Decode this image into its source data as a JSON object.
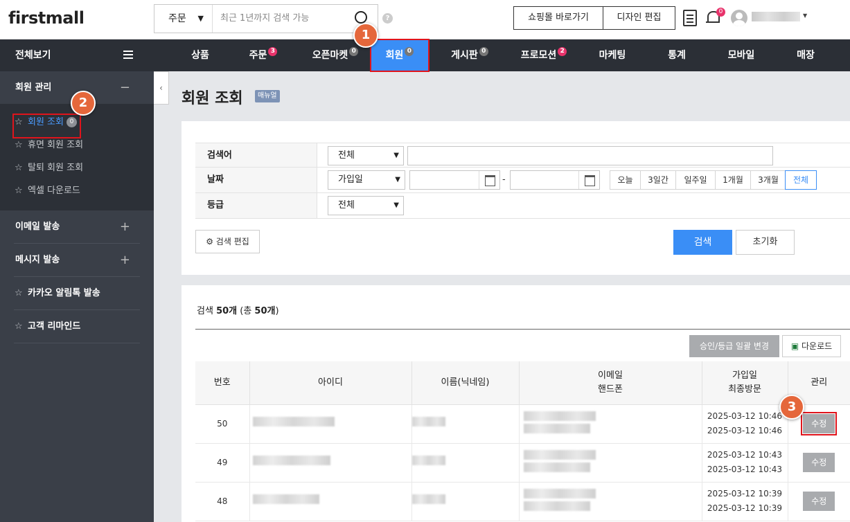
{
  "header": {
    "logo": "firstmall",
    "search_scope": "주문",
    "search_placeholder": "최근 1년까지 검색 가능",
    "help": "?",
    "shop_link": "쇼핑몰 바로가기",
    "design_edit": "디자인 편집",
    "notification_count": "0"
  },
  "nav": {
    "all_view": "전체보기",
    "items": [
      {
        "label": "상품",
        "badge": ""
      },
      {
        "label": "주문",
        "badge": "3"
      },
      {
        "label": "오픈마켓",
        "badge": "0"
      },
      {
        "label": "회원",
        "badge": "0"
      },
      {
        "label": "게시판",
        "badge": "0"
      },
      {
        "label": "프로모션",
        "badge": "2"
      },
      {
        "label": "마케팅",
        "badge": ""
      },
      {
        "label": "통계",
        "badge": ""
      },
      {
        "label": "모바일",
        "badge": ""
      },
      {
        "label": "매장",
        "badge": ""
      }
    ],
    "active": "회원"
  },
  "sidebar": {
    "group_member": "회원 관리",
    "sub": [
      {
        "label": "회원 조회",
        "count": "0"
      },
      {
        "label": "휴면 회원 조회"
      },
      {
        "label": "탈퇴 회원 조회"
      },
      {
        "label": "엑셀 다운로드"
      }
    ],
    "group_email": "이메일 발송",
    "group_message": "메시지 발송",
    "kakao": "카카오 알림톡 발송",
    "remind": "고객 리마인드",
    "collapse": "‹"
  },
  "page": {
    "title": "회원 조회",
    "manual": "매뉴얼"
  },
  "filter": {
    "keyword_label": "검색어",
    "keyword_scope": "전체",
    "date_label": "날짜",
    "date_type": "가입일",
    "date_sep": "-",
    "ranges": [
      "오늘",
      "3일간",
      "일주일",
      "1개월",
      "3개월",
      "전체"
    ],
    "range_selected": "전체",
    "grade_label": "등급",
    "grade_value": "전체",
    "edit_search": "검색 편집",
    "search_btn": "검색",
    "reset_btn": "초기화"
  },
  "results": {
    "summary_prefix": "검색 ",
    "summary_count": "50개",
    "summary_suffix": " (총 ",
    "summary_total": "50개",
    "summary_end": ")",
    "bulk_change": "승인/등급 일괄 변경",
    "download": "다운로드",
    "headers": {
      "no": "번호",
      "id": "아이디",
      "name": "이름(닉네임)",
      "email": "이메일",
      "phone": "핸드폰",
      "joined": "가입일",
      "last_visit": "최종방문",
      "manage": "관리"
    },
    "rows": [
      {
        "no": "50",
        "joined": "2025-03-12 10:46",
        "last_visit": "2025-03-12 10:46",
        "action": "수정"
      },
      {
        "no": "49",
        "joined": "2025-03-12 10:43",
        "last_visit": "2025-03-12 10:43",
        "action": "수정"
      },
      {
        "no": "48",
        "joined": "2025-03-12 10:39",
        "last_visit": "2025-03-12 10:39",
        "action": "수정"
      }
    ]
  },
  "annotations": {
    "step1": "1",
    "step2": "2",
    "step3": "3"
  },
  "colors": {
    "accent": "#3a8ef6",
    "highlight": "#e0141c",
    "step_marker": "#e5673b",
    "badge": "#e8336b"
  }
}
